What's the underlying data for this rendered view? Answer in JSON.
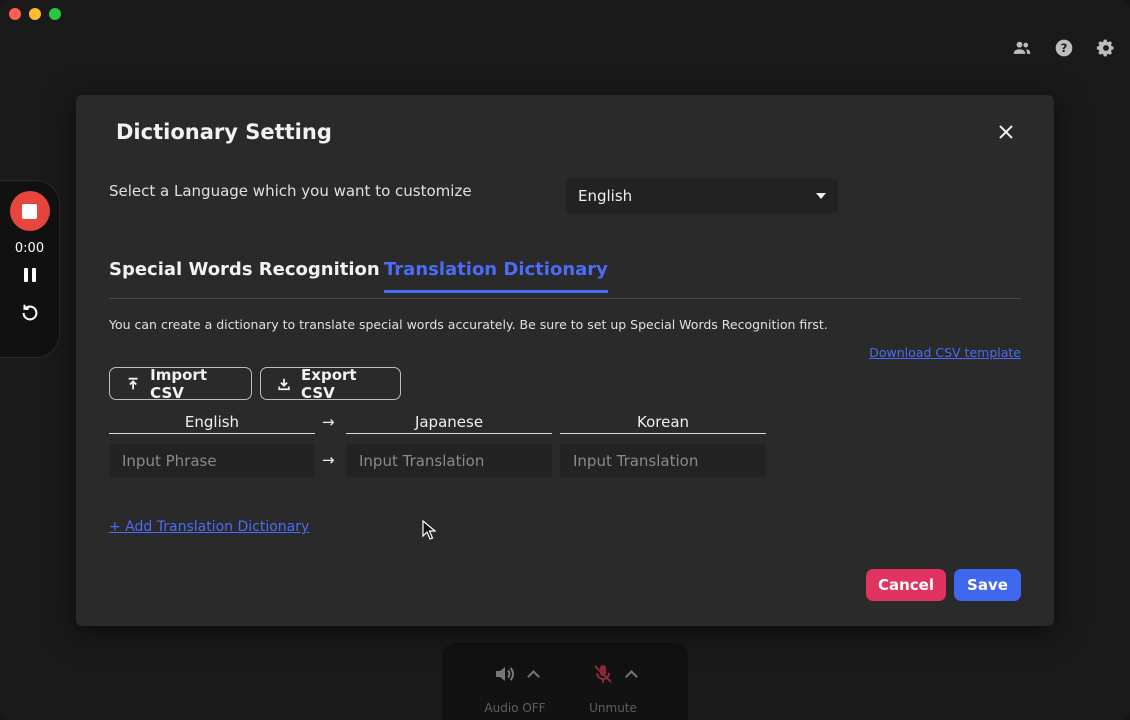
{
  "modal": {
    "title": "Dictionary Setting",
    "language_label": "Select a Language which you want to customize",
    "language_selected": "English",
    "tabs": [
      {
        "label": "Special Words Recognition",
        "active": false
      },
      {
        "label": "Translation Dictionary",
        "active": true
      }
    ],
    "description": "You can create a dictionary to translate special words accurately. Be sure to set up Special Words Recognition first.",
    "download_link": "Download CSV template",
    "import_label": "Import CSV",
    "export_label": "Export CSV",
    "columns": [
      "English",
      "Japanese",
      "Korean"
    ],
    "arrow": "→",
    "placeholders": {
      "phrase": "Input Phrase",
      "translation_ja": "Input Translation",
      "translation_ko": "Input Translation"
    },
    "add_link": "+ Add Translation Dictionary",
    "cancel_label": "Cancel",
    "save_label": "Save"
  },
  "sidebar": {
    "timer": "0:00"
  },
  "bottom_bar": {
    "audio_label": "Audio OFF",
    "mute_label": "Unmute"
  },
  "colors": {
    "accent": "#4a6cf7",
    "cancel": "#e0335f",
    "save": "#3f67f0",
    "record": "#e8453c"
  }
}
